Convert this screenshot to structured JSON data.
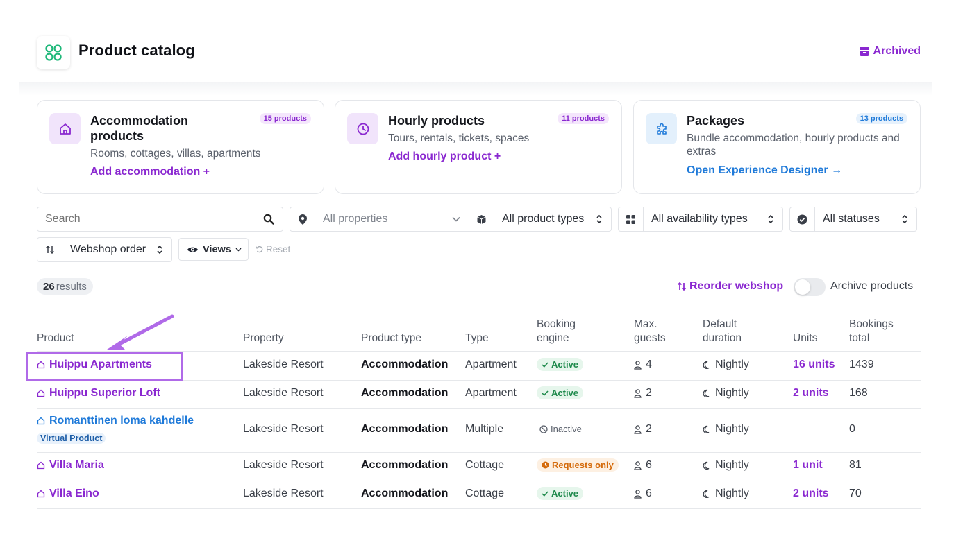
{
  "header": {
    "title": "Product catalog",
    "archived_label": "Archived"
  },
  "cards": [
    {
      "title": "Accommodation products",
      "badge": "15 products",
      "desc": "Rooms, cottages, villas, apartments",
      "link": "Add accommodation +"
    },
    {
      "title": "Hourly products",
      "badge": "11 products",
      "desc": "Tours, rentals, tickets, spaces",
      "link": "Add hourly product +"
    },
    {
      "title": "Packages",
      "badge": "13 products",
      "desc": "Bundle accommodation, hourly products and extras",
      "link": "Open Experience Designer →"
    }
  ],
  "filters": {
    "search_placeholder": "Search",
    "properties": "All properties",
    "product_types": "All product types",
    "availability_types": "All availability types",
    "statuses": "All statuses",
    "sort": "Webshop order",
    "views": "Views",
    "reset": "Reset"
  },
  "results": {
    "count": "26",
    "label": "results"
  },
  "actions": {
    "reorder": "Reorder webshop",
    "archive_toggle_label": "Archive products",
    "archive_toggle_on": false
  },
  "table": {
    "headers": [
      "Product",
      "Property",
      "Product type",
      "Type",
      "Booking engine",
      "Max. guests",
      "Default duration",
      "Units",
      "Bookings total"
    ],
    "rows": [
      {
        "product": "Huippu Apartments",
        "property": "Lakeside Resort",
        "product_type": "Accommodation",
        "type": "Apartment",
        "booking_engine": "Active",
        "max_guests": "4",
        "duration": "Nightly",
        "units": "16 units",
        "bookings": "1439"
      },
      {
        "product": "Huippu Superior Loft",
        "property": "Lakeside Resort",
        "product_type": "Accommodation",
        "type": "Apartment",
        "booking_engine": "Active",
        "max_guests": "2",
        "duration": "Nightly",
        "units": "2 units",
        "bookings": "168"
      },
      {
        "product": "Romanttinen loma kahdelle",
        "tag": "Virtual Product",
        "property": "Lakeside Resort",
        "product_type": "Accommodation",
        "type": "Multiple",
        "booking_engine": "Inactive",
        "max_guests": "2",
        "duration": "Nightly",
        "units": "",
        "bookings": "0"
      },
      {
        "product": "Villa Maria",
        "property": "Lakeside Resort",
        "product_type": "Accommodation",
        "type": "Cottage",
        "booking_engine": "Requests only",
        "max_guests": "6",
        "duration": "Nightly",
        "units": "1 unit",
        "bookings": "81"
      },
      {
        "product": "Villa Eino",
        "property": "Lakeside Resort",
        "product_type": "Accommodation",
        "type": "Cottage",
        "booking_engine": "Active",
        "max_guests": "6",
        "duration": "Nightly",
        "units": "2 units",
        "bookings": "70"
      }
    ]
  },
  "colors": {
    "accent": "#8a28d0",
    "link_blue": "#1f7ad9",
    "active_bg": "#e6f6ec",
    "active_fg": "#1f8a4c",
    "requests_bg": "#fdf0e2",
    "requests_fg": "#d46a0a",
    "annotation": "#b06ae8"
  }
}
